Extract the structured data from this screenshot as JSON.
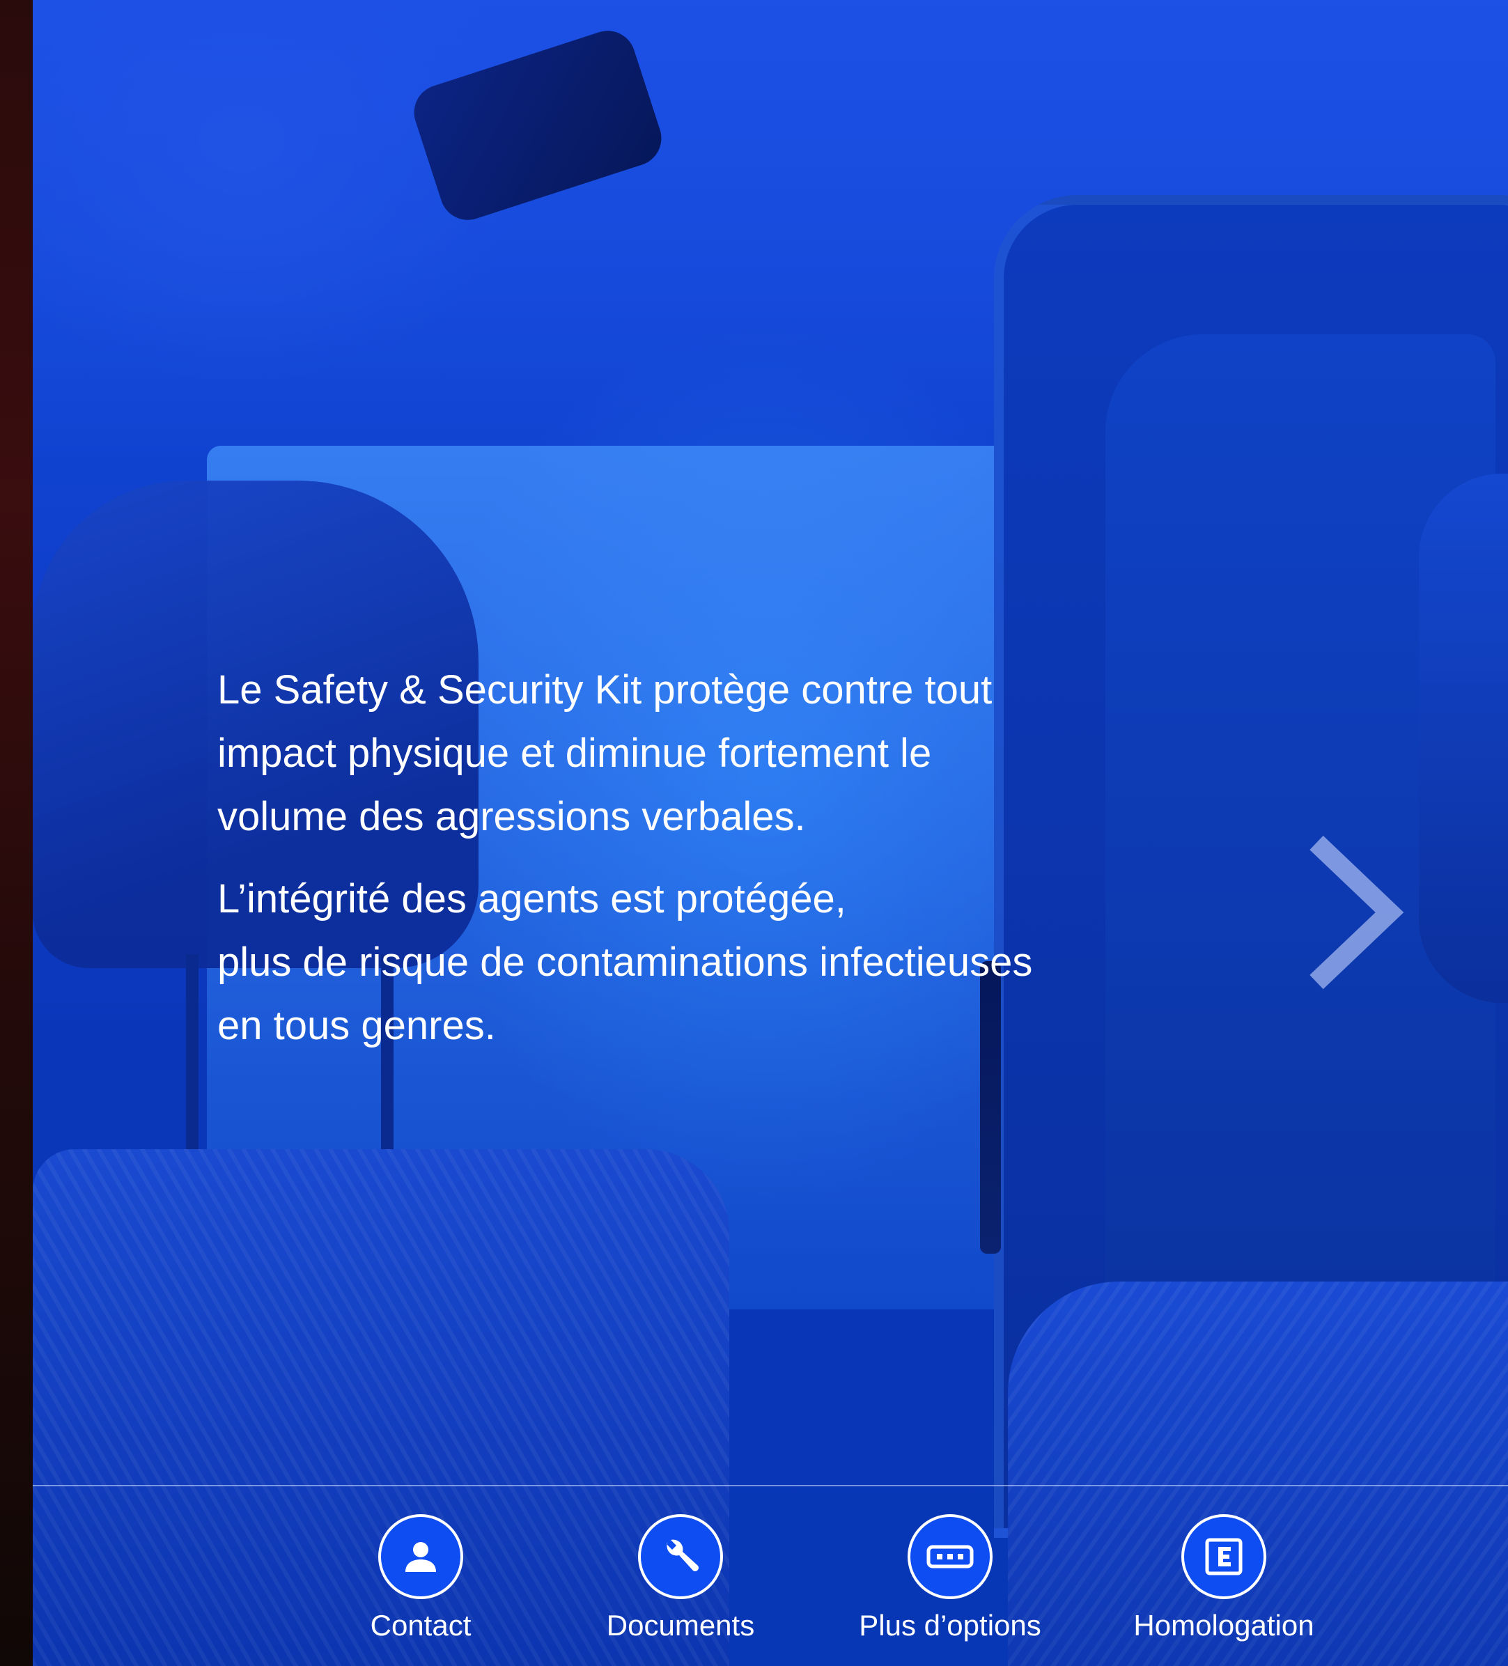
{
  "content": {
    "paragraph_1": "Le Safety & Security Kit protège contre tout\nimpact physique et diminue fortement le\nvolume des agressions verbales.",
    "paragraph_2": "L’intégrité des agents est protégée,\nplus de risque de contaminations infectieuses\nen tous genres."
  },
  "navigation": {
    "next_icon": "chevron-right-icon"
  },
  "bottom_nav": {
    "items": [
      {
        "label": "Contact",
        "icon": "person-icon"
      },
      {
        "label": "Documents",
        "icon": "wrench-icon"
      },
      {
        "label": "Plus d’options",
        "icon": "more-options-icon"
      },
      {
        "label": "Homologation",
        "icon": "homologation-e-icon"
      }
    ]
  },
  "colors": {
    "background_blue": "#0f3fcc",
    "button_blue": "#0d4df2",
    "text": "#ffffff"
  }
}
